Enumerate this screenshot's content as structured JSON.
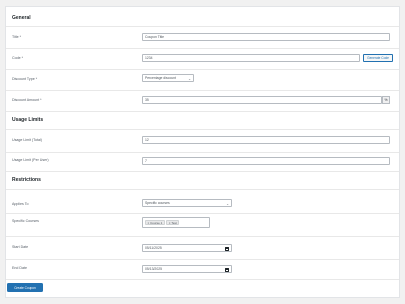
{
  "sections": {
    "general": "General",
    "usage_limits": "Usage Limits",
    "restrictions": "Restrictions"
  },
  "fields": {
    "title": {
      "label": "Title *",
      "value": "Coupon Title"
    },
    "code": {
      "label": "Code *",
      "value": "1234",
      "button": "Generate Code"
    },
    "discount_type": {
      "label": "Discount Type *",
      "value": "Percentage discount"
    },
    "discount_amount": {
      "label": "Discount Amount *",
      "value": "35",
      "suffix": "%"
    },
    "usage_limit_total": {
      "label": "Usage Limit (Total)",
      "value": "12"
    },
    "usage_limit_user": {
      "label": "Usage Limit (Per User)",
      "value": "7"
    },
    "applies_to": {
      "label": "Applies To",
      "value": "Specific courses"
    },
    "specific_courses": {
      "label": "Specific Courses",
      "tags": [
        "Course 1",
        "Test"
      ]
    },
    "start_date": {
      "label": "Start Date",
      "value": "05/11/2025"
    },
    "end_date": {
      "label": "End Date",
      "value": "05/13/2025"
    }
  },
  "actions": {
    "save": "Create Coupon"
  },
  "colors": {
    "accent": "#2271b1",
    "background": "#f1f1f1"
  },
  "icons": {
    "select": "chevron-down-icon",
    "date": "calendar-icon",
    "tag_remove": "close-icon"
  }
}
